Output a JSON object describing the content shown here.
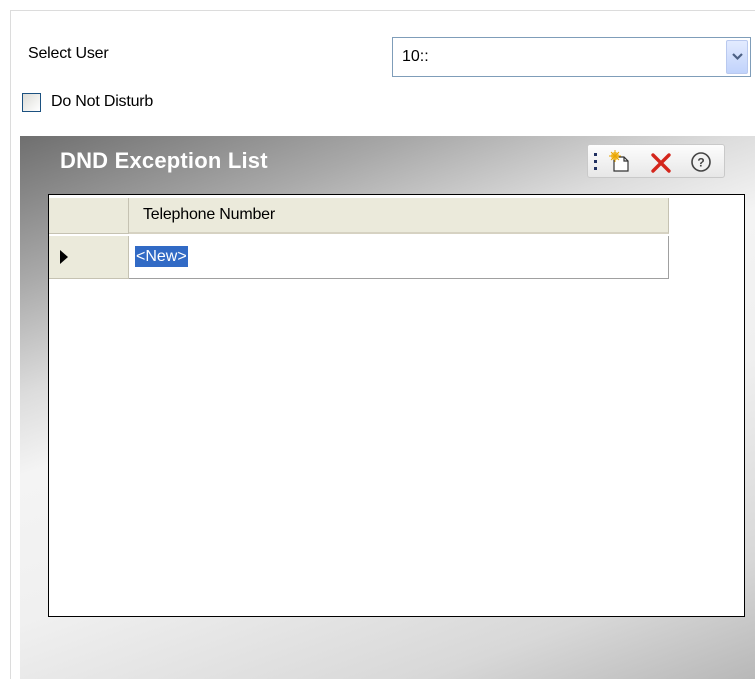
{
  "user_select": {
    "label": "Select User",
    "value": "10::"
  },
  "dnd": {
    "label": "Do Not Disturb",
    "checked": false
  },
  "exception_list": {
    "title": "DND Exception List",
    "toolbar": {
      "icons": [
        "new-icon",
        "delete-icon",
        "help-icon"
      ]
    },
    "grid": {
      "columns": [
        "Telephone Number"
      ],
      "rows": [
        {
          "telephone_number": "<New>",
          "current": true
        }
      ]
    }
  },
  "colors": {
    "title_text": "#ffffff",
    "selection_bg": "#316ac5",
    "header_bg": "#ebeadb",
    "delete_red": "#d4261c"
  }
}
